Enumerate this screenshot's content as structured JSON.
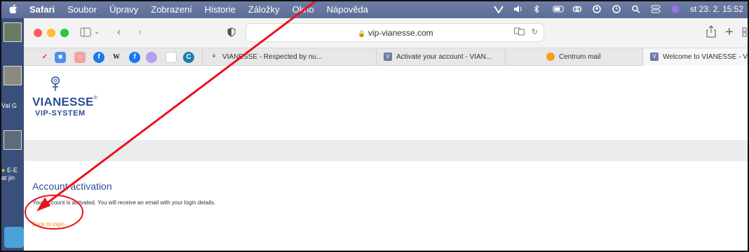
{
  "menubar": {
    "items": [
      "Safari",
      "Soubor",
      "Úpravy",
      "Zobrazení",
      "Historie",
      "Záložky",
      "Okno",
      "Nápověda"
    ],
    "clock": "st 23. 2.  15:52"
  },
  "desktop": {
    "label1": "Val G",
    "label2": "E-E",
    "label3": "at jin"
  },
  "browser": {
    "url": "vip-vianesse.com",
    "favorites": [
      "W"
    ],
    "tabs": [
      {
        "label": "VIANESSE - Respected by nu..."
      },
      {
        "label": "Activate your account - VIAN..."
      },
      {
        "label": "Centrum mail"
      },
      {
        "label": "Welcome to VIANESSE - VIA..."
      }
    ]
  },
  "page": {
    "logo_name": "VIANESSE",
    "logo_reg": "®",
    "logo_sub": "VIP-SYSTEM",
    "title": "Account activation",
    "message": "Your account is activated. You will receive an email with your login details.",
    "back_link": "Back to login"
  },
  "colors": {
    "menubar": "#5c6d97",
    "brand_blue": "#2d4f96",
    "link_orange": "#e8920f",
    "annotation_red": "#e8141c"
  }
}
